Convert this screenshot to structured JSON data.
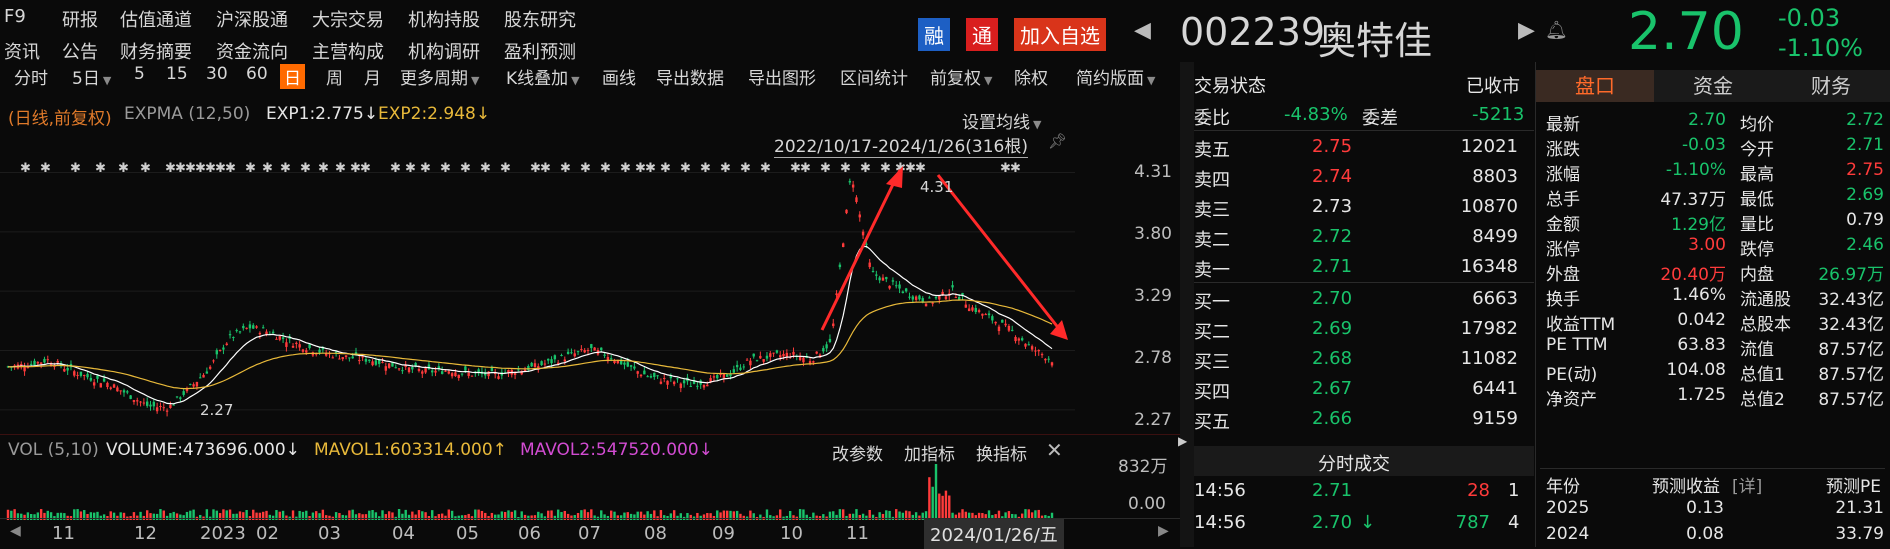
{
  "top_nav": {
    "row1": [
      "F9",
      "研报",
      "估值通道",
      "沪深股通",
      "大宗交易",
      "机构持股",
      "股东研究"
    ],
    "row2": [
      "资讯",
      "公告",
      "财务摘要",
      "资金流向",
      "主营构成",
      "机构调研",
      "盈利预测"
    ]
  },
  "stock_header": {
    "tag_rong": "融",
    "tag_tong": "通",
    "add_watch": "加入自选",
    "code": "002239",
    "name": "奥特佳",
    "price": "2.70",
    "change": "-0.03",
    "change_pct": "-1.10%"
  },
  "toolbar": {
    "items": [
      "分时",
      "5日",
      "5",
      "15",
      "30",
      "60",
      "日",
      "周",
      "月",
      "更多周期",
      "K线叠加",
      "画线",
      "导出数据",
      "导出图形",
      "区间统计",
      "前复权",
      "除权",
      "简约版面"
    ],
    "dropdown_items": [
      "5日",
      "更多周期",
      "K线叠加",
      "前复权",
      "简约版面"
    ],
    "active": "日"
  },
  "chart_legend": {
    "mode": "(日线,前复权)",
    "expma": "EXPMA (12,50)",
    "exp1": "EXP1:2.775↓",
    "exp2": "EXP2:2.948↓",
    "set_ma": "设置均线",
    "range": "2022/10/17-2024/1/26(316根)"
  },
  "vol_legend": {
    "vol": "VOL (5,10)",
    "volume": "VOLUME:473696.000↓",
    "mavol1": "MAVOL1:603314.000↑",
    "mavol2": "MAVOL2:547520.000↓",
    "btn_param": "改参数",
    "btn_add": "加指标",
    "btn_switch": "换指标",
    "vol_top": "832万",
    "vol_zero": "0.00"
  },
  "chart_data": {
    "type": "candlestick",
    "y_ticks": [
      "4.31",
      "3.80",
      "3.29",
      "2.78",
      "2.27"
    ],
    "ylim": [
      2.2,
      4.4
    ],
    "x_ticks": [
      "11",
      "12",
      "2023",
      "02",
      "03",
      "04",
      "05",
      "06",
      "07",
      "08",
      "09",
      "10",
      "11"
    ],
    "current_date_label": "2024/01/26/五",
    "annotations": {
      "high": "4.31",
      "low": "2.27"
    },
    "close_path": [
      2.64,
      2.66,
      2.7,
      2.62,
      2.55,
      2.5,
      2.4,
      2.3,
      2.29,
      2.45,
      2.62,
      2.88,
      2.98,
      2.94,
      2.86,
      2.8,
      2.75,
      2.72,
      2.7,
      2.66,
      2.62,
      2.6,
      2.61,
      2.58,
      2.57,
      2.6,
      2.63,
      2.68,
      2.74,
      2.79,
      2.73,
      2.63,
      2.55,
      2.52,
      2.49,
      2.52,
      2.58,
      2.7,
      2.73,
      2.75,
      2.7,
      2.85,
      4.31,
      3.45,
      3.35,
      3.25,
      3.2,
      3.3,
      3.15,
      3.05,
      2.95,
      2.8,
      2.7
    ]
  },
  "quote_panel": {
    "title": "交易状态",
    "status": "已收市",
    "webi_label": "委比",
    "webi": "-4.83%",
    "weicha_label": "委差",
    "weicha": "-5213",
    "asks": [
      {
        "label": "卖五",
        "price": "2.75",
        "vol": "12021"
      },
      {
        "label": "卖四",
        "price": "2.74",
        "vol": "8803"
      },
      {
        "label": "卖三",
        "price": "2.73",
        "vol": "10870"
      },
      {
        "label": "卖二",
        "price": "2.72",
        "vol": "8499"
      },
      {
        "label": "卖一",
        "price": "2.71",
        "vol": "16348"
      }
    ],
    "bids": [
      {
        "label": "买一",
        "price": "2.70",
        "vol": "6663"
      },
      {
        "label": "买二",
        "price": "2.69",
        "vol": "17982"
      },
      {
        "label": "买三",
        "price": "2.68",
        "vol": "11082"
      },
      {
        "label": "买四",
        "price": "2.67",
        "vol": "6441"
      },
      {
        "label": "买五",
        "price": "2.66",
        "vol": "9159"
      }
    ],
    "ticks_title": "分时成交",
    "ticks": [
      {
        "time": "14:56",
        "price": "2.71",
        "arrow": "",
        "vol": "28",
        "n": "1"
      },
      {
        "time": "14:56",
        "price": "2.70",
        "arrow": "↓",
        "vol": "787",
        "n": "4"
      }
    ]
  },
  "right_panel": {
    "tabs": [
      "盘口",
      "资金",
      "财务"
    ],
    "active_tab": "盘口",
    "rows": [
      [
        "最新",
        "2.70",
        "均价",
        "2.72"
      ],
      [
        "涨跌",
        "-0.03",
        "今开",
        "2.71"
      ],
      [
        "涨幅",
        "-1.10%",
        "最高",
        "2.75"
      ],
      [
        "总手",
        "47.37万",
        "最低",
        "2.69"
      ],
      [
        "金额",
        "1.29亿",
        "量比",
        "0.79"
      ],
      [
        "涨停",
        "3.00",
        "跌停",
        "2.46"
      ],
      [
        "外盘",
        "20.40万",
        "内盘",
        "26.97万"
      ],
      [
        "换手",
        "1.46%",
        "流通股",
        "32.43亿"
      ],
      [
        "收益TTM",
        "0.042",
        "总股本",
        "32.43亿"
      ],
      [
        "PE TTM",
        "63.83",
        "流值",
        "87.57亿"
      ],
      [
        "PE(动)",
        "104.08",
        "总值1",
        "87.57亿"
      ],
      [
        "净资产",
        "1.725",
        "总值2",
        "87.57亿"
      ]
    ],
    "forecast_header": [
      "年份",
      "预测收益",
      "[详]",
      "预测PE"
    ],
    "forecast": [
      [
        "2025",
        "0.13",
        "21.31"
      ],
      [
        "2024",
        "0.08",
        "33.79"
      ]
    ],
    "colors": {
      "up": "#ff3b3b",
      "down": "#19c36b",
      "accent": "#ff6a00"
    }
  }
}
